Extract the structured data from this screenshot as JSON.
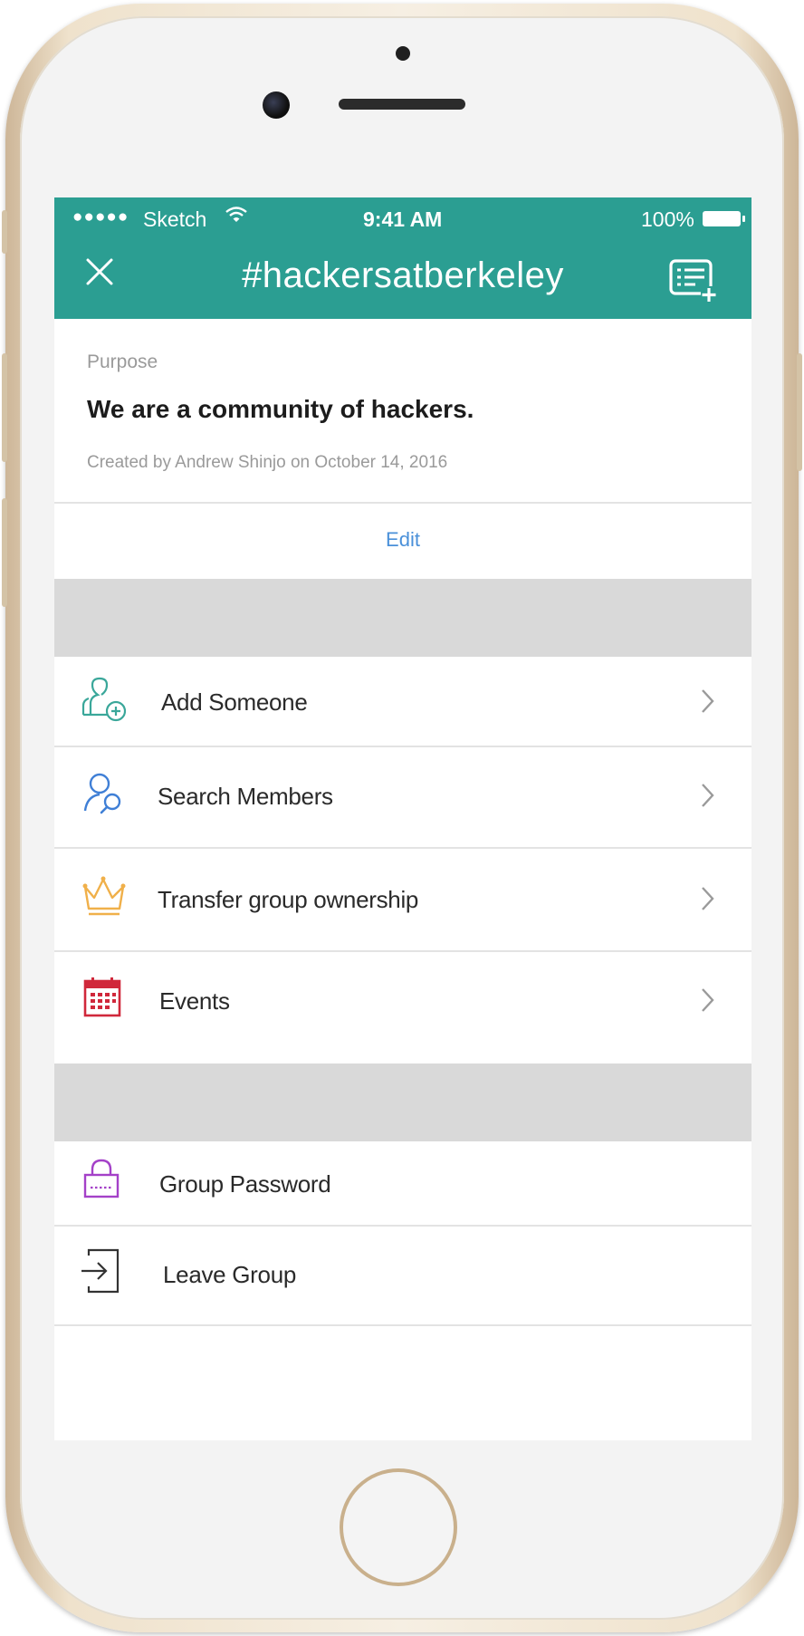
{
  "status_bar": {
    "signal": "●●●●●",
    "carrier": "Sketch",
    "wifi_icon": "wifi-icon",
    "time": "9:41 AM",
    "battery": "100%"
  },
  "nav": {
    "close_label": "X",
    "title": "#hackersatberkeley",
    "compose_icon": "new-post-icon"
  },
  "purpose": {
    "label": "Purpose",
    "text": "We are a community of hackers.",
    "meta": "Created by Andrew Shinjo on October 14, 2016",
    "edit_label": "Edit"
  },
  "menu_section_1": [
    {
      "label": "Add Someone",
      "icon": "add-user-icon",
      "color": "#3aa79a"
    },
    {
      "label": "Search Members",
      "icon": "search-members-icon",
      "color": "#3f7fd6"
    },
    {
      "label": "Transfer group ownership",
      "icon": "crown-icon",
      "color": "#f0b04a"
    },
    {
      "label": "Events",
      "icon": "calendar-icon",
      "color": "#d0283b"
    }
  ],
  "menu_section_2": [
    {
      "label": "Group Password",
      "icon": "lock-icon",
      "color": "#a441c8"
    },
    {
      "label": "Leave Group",
      "icon": "exit-icon",
      "color": "#333333"
    }
  ],
  "colors": {
    "accent": "#2b9e92",
    "link": "#4a90d9",
    "separator_band": "#d9d9d9"
  }
}
